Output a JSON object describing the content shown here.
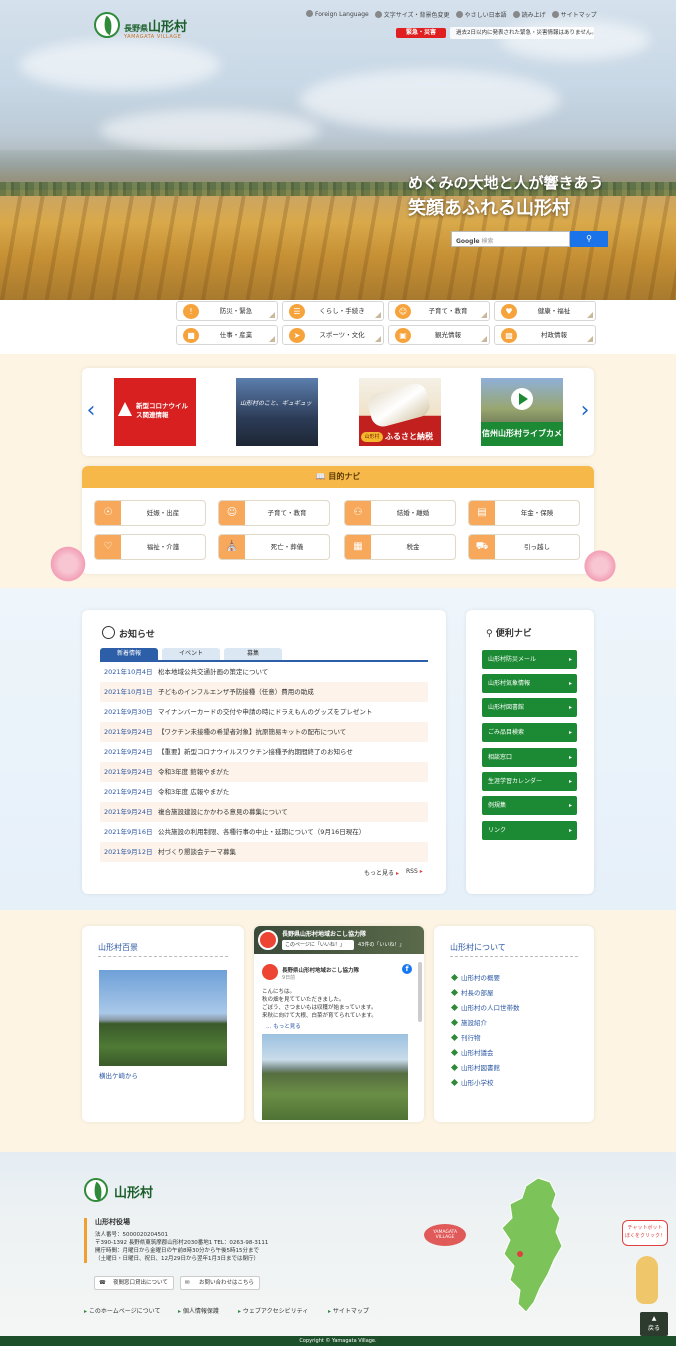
{
  "header": {
    "logo_pref": "長野県",
    "logo_name": "山形村",
    "logo_en": "YAMAGATA VILLAGE",
    "top_links": [
      "Foreign Language",
      "文字サイズ・背景色変更",
      "やさしい日本語",
      "読み上げ",
      "サイトマップ"
    ],
    "emergency_label": "緊急・災害",
    "emergency_text": "過去2日以内に発表された緊急・災害情報はありません。",
    "catch1": "めぐみの大地と人が響きあう",
    "catch2": "笑顔あふれる山形村",
    "search_brand": "Google",
    "search_placeholder": "検索",
    "search_icon": "magnifier-icon"
  },
  "categories": [
    {
      "label": "防災・緊急",
      "icon": "warning-icon"
    },
    {
      "label": "くらし・手続き",
      "icon": "document-icon"
    },
    {
      "label": "子育て・教育",
      "icon": "child-icon"
    },
    {
      "label": "健康・福祉",
      "icon": "heart-icon"
    },
    {
      "label": "仕事・産業",
      "icon": "factory-icon"
    },
    {
      "label": "スポーツ・文化",
      "icon": "runner-icon"
    },
    {
      "label": "観光情報",
      "icon": "bag-icon"
    },
    {
      "label": "村政情報",
      "icon": "book-icon"
    }
  ],
  "banners": [
    {
      "text": "新型コロナウイルス関連情報"
    },
    {
      "text": "山形村のこと、ギュギュッ"
    },
    {
      "text": "ふるさと納税",
      "badge": "山形村"
    },
    {
      "text": "信州山形村ライブカメラ"
    }
  ],
  "purpose_nav": {
    "title": "目的ナビ",
    "items": [
      "妊娠・出産",
      "子育て・教育",
      "結婚・離婚",
      "年金・保険",
      "福祉・介護",
      "死亡・葬儀",
      "税金",
      "引っ越し"
    ]
  },
  "news": {
    "title": "お知らせ",
    "tabs": [
      "新着情報",
      "イベント",
      "募集"
    ],
    "items": [
      {
        "date": "2021年10月4日",
        "title": "松本地域公共交通計画の策定について"
      },
      {
        "date": "2021年10月1日",
        "title": "子どものインフルエンザ予防接種（任意）費用の助成"
      },
      {
        "date": "2021年9月30日",
        "title": "マイナンバーカードの交付や申請の時にドラえもんのグッズをプレゼント"
      },
      {
        "date": "2021年9月24日",
        "title": "【ワクチン未接種の希望者対象】抗原簡易キットの配布について"
      },
      {
        "date": "2021年9月24日",
        "title": "【重要】新型コロナウイルスワクチン接種予約期間終了のお知らせ"
      },
      {
        "date": "2021年9月24日",
        "title": "令和3年度 館報やまがた"
      },
      {
        "date": "2021年9月24日",
        "title": "令和3年度 広報やまがた"
      },
      {
        "date": "2021年9月24日",
        "title": "複合施設建設にかかわる意見の募集について"
      },
      {
        "date": "2021年9月16日",
        "title": "公共施設の利用制限、各種行事の中止・延期について（9月16日現在）"
      },
      {
        "date": "2021年9月12日",
        "title": "村づくり懇談会テーマ募集"
      }
    ],
    "more": "もっと見る",
    "rss": "RSS"
  },
  "benri": {
    "title": "便利ナビ",
    "items": [
      "山形村防災メール",
      "山形村気象情報",
      "山形村図書館",
      "ごみ品目検索",
      "相談窓口",
      "生涯学習カレンダー",
      "例規集",
      "リンク"
    ]
  },
  "hyakkei": {
    "title": "山形村百景",
    "caption": "横出ケ崎から"
  },
  "facebook": {
    "page_name": "長野県山形村地域おこし協力隊",
    "like_label": "このページに「いいね！」",
    "like_count": "43件の「いいね！」",
    "post_author": "長野県山形村地域おこし協力隊",
    "post_time": "9日前",
    "post_text": "こんにちは。\n秋の畑を見てていただきました。\nごぼう、さつまいもは収穫が始まっています。\n来秋に向けて大根、白菜が育てられています。",
    "more": "… もっと見る"
  },
  "about": {
    "title": "山形村について",
    "items": [
      "山形村の概要",
      "村長の部屋",
      "山形村の人口世帯数",
      "施設紹介",
      "刊行物",
      "山形村議会",
      "山形村図書館",
      "山形小学校"
    ]
  },
  "footer": {
    "logo": "山形村",
    "office": "山形村役場",
    "lines": [
      "法人番号：5000020204501",
      "〒390-1392 長野県東筑摩郡山形村2030番地1 TEL：0263-98-3111",
      "開庁時間：月曜日から金曜日の午前8時30分から午後5時15分まで",
      "（土曜日・日曜日、祝日、12月29日から翌年1月3日までは閉庁）"
    ],
    "btn1": "夜間窓口貸出について",
    "btn2": "お問い合わせはこちら",
    "links": [
      "このホームページについて",
      "個人情報保護",
      "ウェブアクセシビリティ",
      "サイトマップ"
    ],
    "map_label": "YAMAGATA VILLAGE",
    "chatbot1": "チャットボット",
    "chatbot2": "ぼくをクリック！",
    "pagetop": "戻る",
    "copyright": "Copyright © Yamagata Village."
  },
  "colors": {
    "accent": "#f7a33c",
    "green": "#1c8a34",
    "blue": "#2b57a4",
    "emergency": "#e02020"
  }
}
